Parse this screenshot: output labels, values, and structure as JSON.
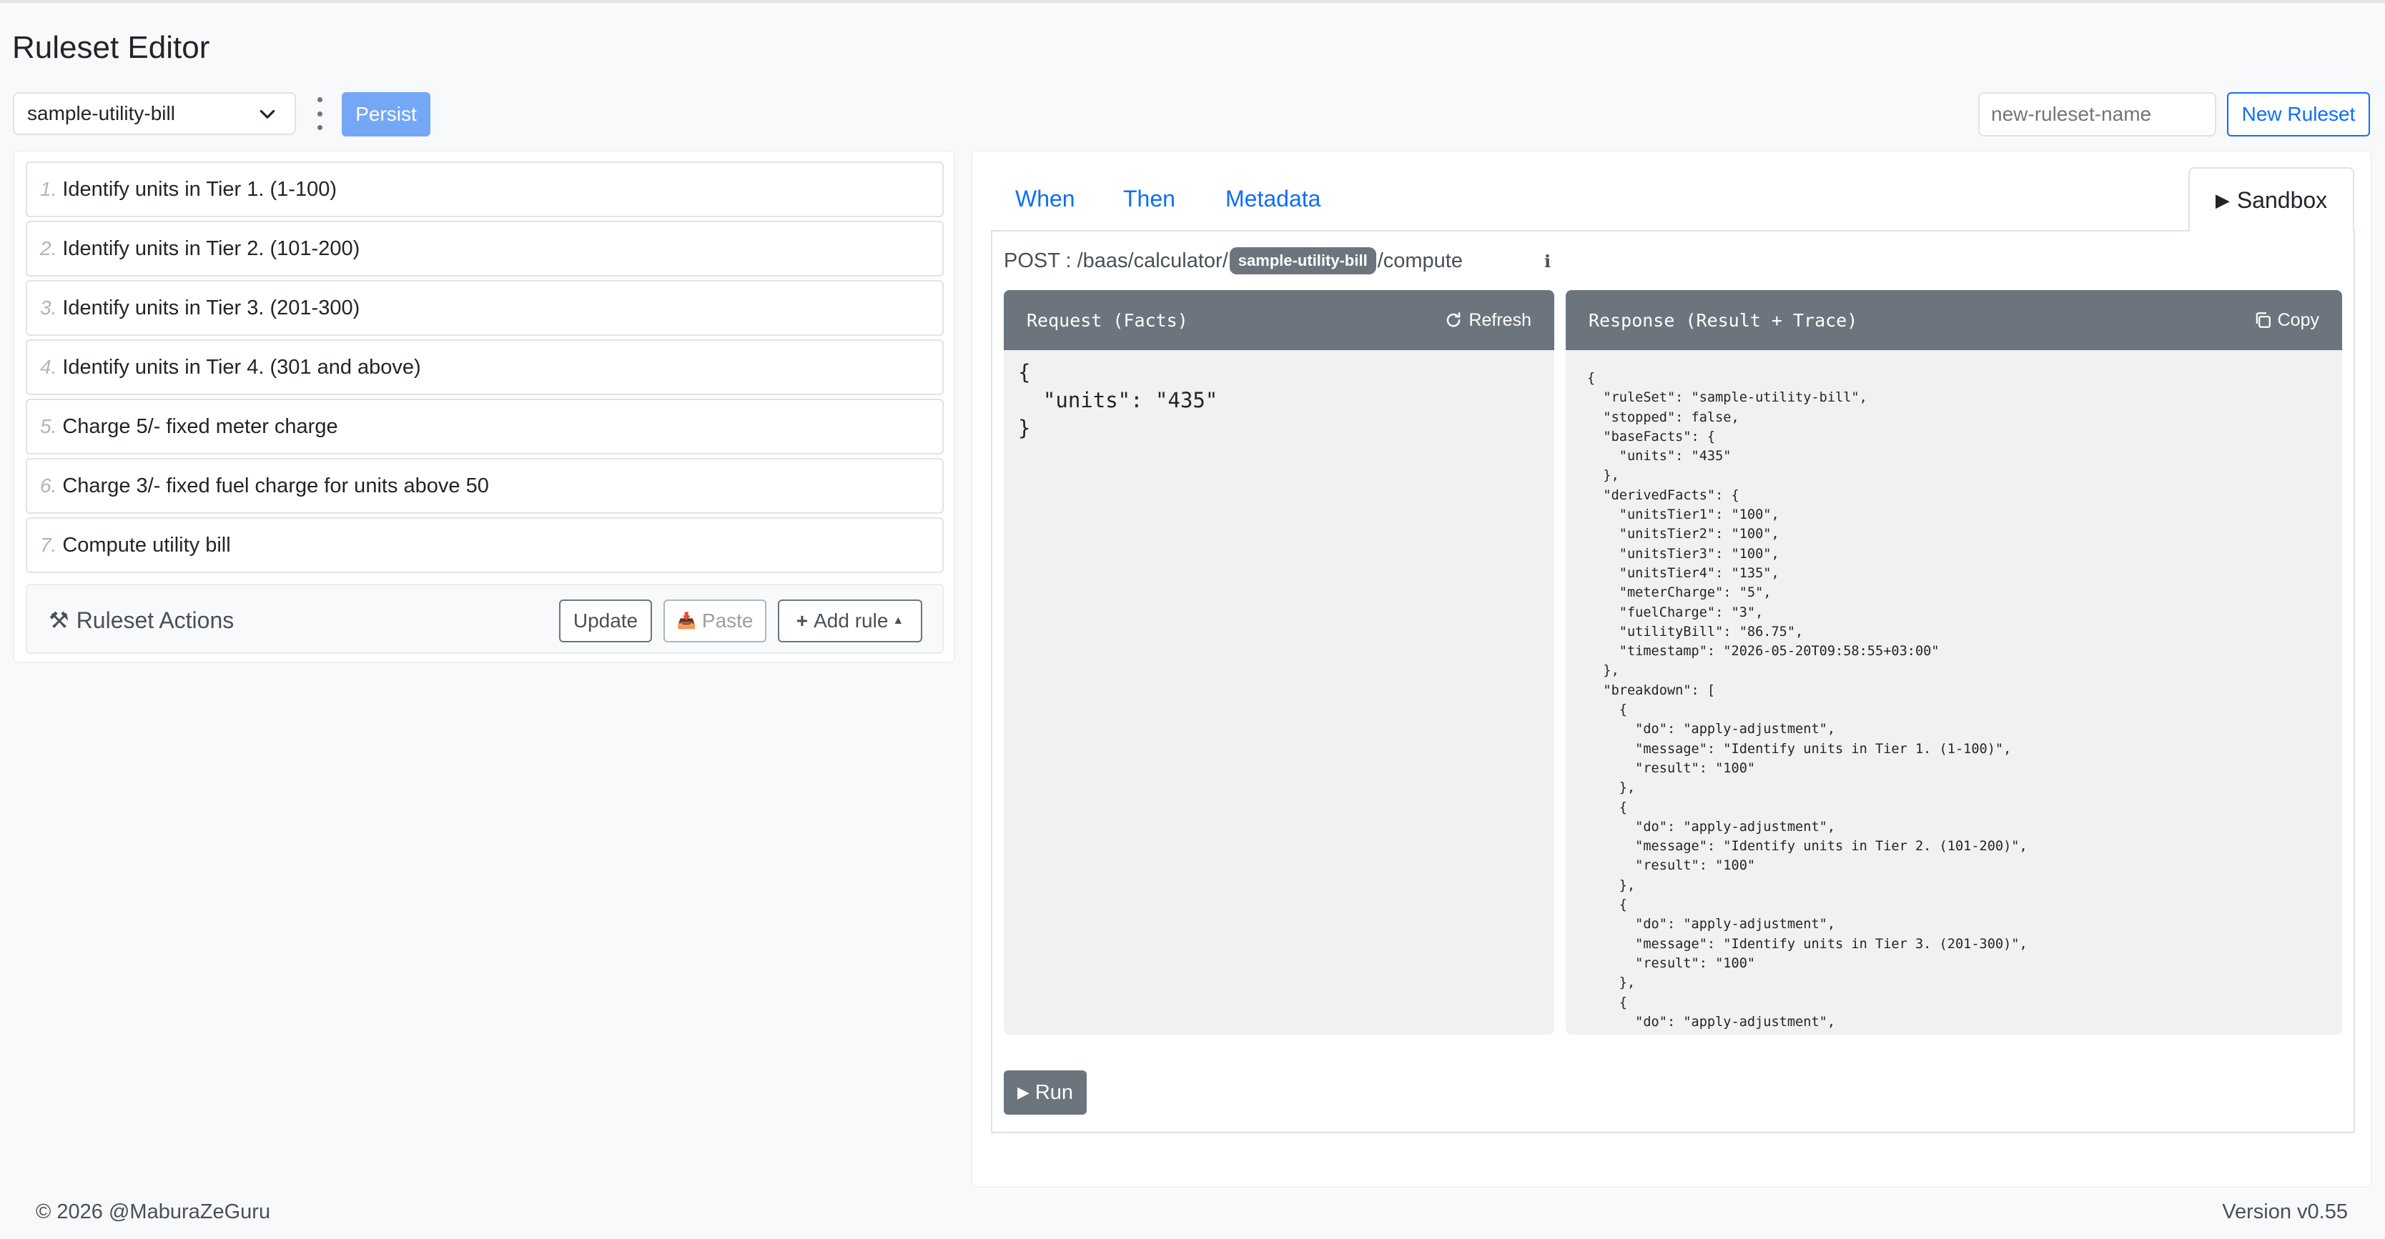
{
  "header": {
    "title": "Ruleset Editor"
  },
  "toolbar": {
    "selected_ruleset": "sample-utility-bill",
    "persist_label": "Persist",
    "new_ruleset_placeholder": "new-ruleset-name",
    "new_ruleset_label": "New Ruleset"
  },
  "rules": [
    {
      "num": "1.",
      "label": "Identify units in Tier 1. (1-100)"
    },
    {
      "num": "2.",
      "label": "Identify units in Tier 2. (101-200)"
    },
    {
      "num": "3.",
      "label": "Identify units in Tier 3. (201-300)"
    },
    {
      "num": "4.",
      "label": "Identify units in Tier 4. (301 and above)"
    },
    {
      "num": "5.",
      "label": "Charge 5/- fixed meter charge"
    },
    {
      "num": "6.",
      "label": "Charge 3/- fixed fuel charge for units above 50"
    },
    {
      "num": "7.",
      "label": "Compute utility bill"
    }
  ],
  "actions": {
    "title": "Ruleset Actions",
    "update_label": "Update",
    "paste_label": "Paste",
    "add_rule_label": "Add rule"
  },
  "tabs": {
    "when": "When",
    "then": "Then",
    "metadata": "Metadata",
    "sandbox": "Sandbox"
  },
  "sandbox": {
    "endpoint_prefix": "POST : /baas/calculator/",
    "endpoint_badge": "sample-utility-bill",
    "endpoint_suffix": "/compute",
    "info": "ℹ",
    "request_title": "Request (Facts)",
    "refresh_label": "Refresh",
    "response_title": "Response (Result + Trace)",
    "copy_label": "Copy",
    "request_body": "{\n  \"units\": \"435\"\n}",
    "response_body": "{\n  \"ruleSet\": \"sample-utility-bill\",\n  \"stopped\": false,\n  \"baseFacts\": {\n    \"units\": \"435\"\n  },\n  \"derivedFacts\": {\n    \"unitsTier1\": \"100\",\n    \"unitsTier2\": \"100\",\n    \"unitsTier3\": \"100\",\n    \"unitsTier4\": \"135\",\n    \"meterCharge\": \"5\",\n    \"fuelCharge\": \"3\",\n    \"utilityBill\": \"86.75\",\n    \"timestamp\": \"2026-05-20T09:58:55+03:00\"\n  },\n  \"breakdown\": [\n    {\n      \"do\": \"apply-adjustment\",\n      \"message\": \"Identify units in Tier 1. (1-100)\",\n      \"result\": \"100\"\n    },\n    {\n      \"do\": \"apply-adjustment\",\n      \"message\": \"Identify units in Tier 2. (101-200)\",\n      \"result\": \"100\"\n    },\n    {\n      \"do\": \"apply-adjustment\",\n      \"message\": \"Identify units in Tier 3. (201-300)\",\n      \"result\": \"100\"\n    },\n    {\n      \"do\": \"apply-adjustment\",",
    "run_label": "Run"
  },
  "footer": {
    "copyright": "© 2026 @MaburaZeGuru",
    "version": "Version v0.55"
  },
  "colors": {
    "accent": "#0d6efd",
    "persist": "#74a7f6",
    "header_gray": "#6c757d"
  },
  "icons": [
    "chevron-down-icon",
    "kebab-menu-icon",
    "tools-icon",
    "paste-icon",
    "plus-icon",
    "caret-up-icon",
    "play-icon",
    "refresh-icon",
    "copy-icon",
    "info-icon"
  ]
}
